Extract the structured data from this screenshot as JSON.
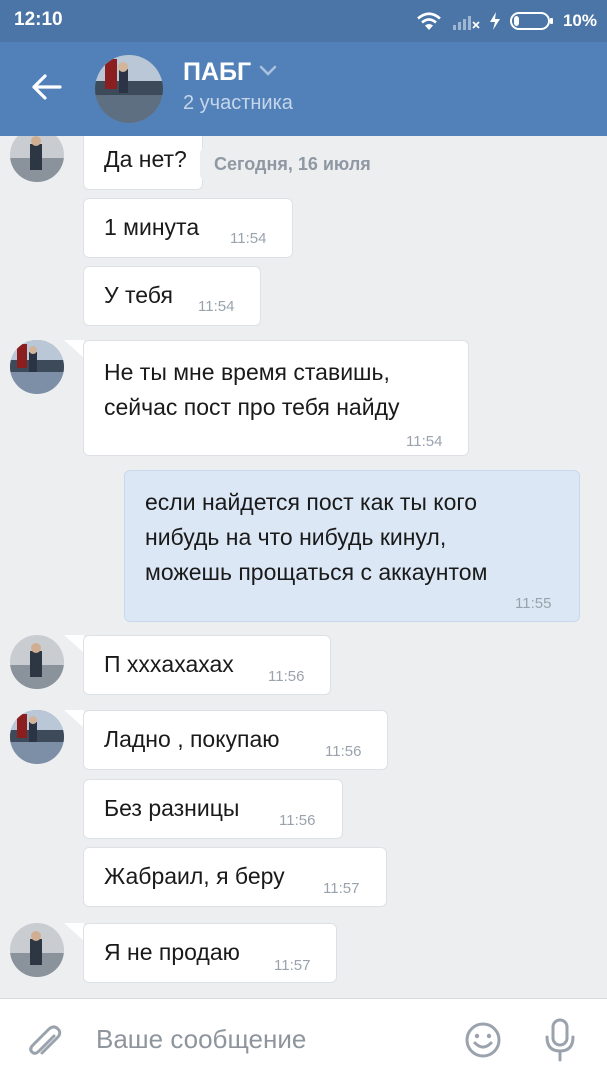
{
  "status_bar": {
    "time": "12:10",
    "battery": "10%",
    "icons": [
      "wifi-icon",
      "signal-icon",
      "charging-icon",
      "battery-icon"
    ]
  },
  "header": {
    "title": "ПАБГ",
    "subtitle": "2 участника",
    "icons": [
      "back-arrow-icon",
      "chevron-down-icon"
    ]
  },
  "date_pill": "Сегодня, 16 июля",
  "messages": [
    {
      "direction": "in",
      "text": "Да нет?",
      "time": ""
    },
    {
      "direction": "in",
      "text": "1 минута",
      "time": "11:54"
    },
    {
      "direction": "in",
      "text": "У тебя",
      "time": "11:54"
    },
    {
      "direction": "in",
      "lines": [
        "Не ты мне время ставишь,",
        "сейчас пост про тебя найду"
      ],
      "time": "11:54"
    },
    {
      "direction": "out",
      "lines": [
        "если найдется пост как ты кого",
        "нибудь на что нибудь кинул,",
        "можешь прощаться с аккаунтом"
      ],
      "time": "11:55"
    },
    {
      "direction": "in",
      "text": "П xxxахахах",
      "time": "11:56"
    },
    {
      "direction": "in",
      "text": "Ладно , покупаю",
      "time": "11:56"
    },
    {
      "direction": "in",
      "text": "Без разницы",
      "time": "11:56"
    },
    {
      "direction": "in",
      "text": "Жабраил, я беру",
      "time": "11:57"
    },
    {
      "direction": "in",
      "text": "Я не продаю",
      "time": "11:57"
    }
  ],
  "composer": {
    "placeholder": "Ваше сообщение",
    "icons": [
      "paperclip-icon",
      "emoji-icon",
      "microphone-icon"
    ]
  },
  "colors": {
    "header": "#5181b8",
    "status_bar": "#4a75a6",
    "background": "#edeef0",
    "incoming_bubble": "#ffffff",
    "outgoing_bubble": "#dbe7f5"
  }
}
